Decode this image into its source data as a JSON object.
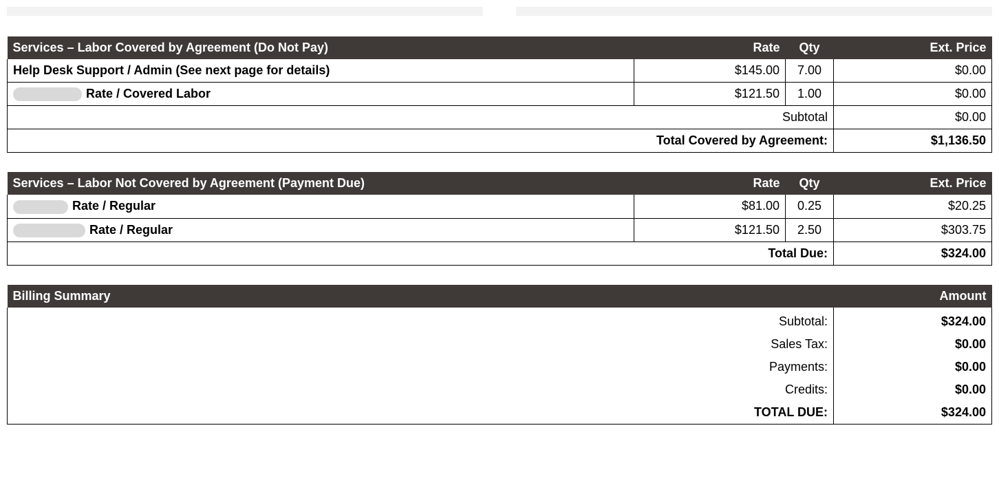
{
  "covered": {
    "title": "Services – Labor Covered by Agreement (Do Not Pay)",
    "cols": {
      "rate": "Rate",
      "qty": "Qty",
      "ext": "Ext. Price"
    },
    "rows": [
      {
        "desc": "Help Desk Support / Admin (See next page for details)",
        "rate": "$145.00",
        "qty": "7.00",
        "ext": "$0.00",
        "redact_w": 0
      },
      {
        "desc": "Rate / Covered Labor",
        "rate": "$121.50",
        "qty": "1.00",
        "ext": "$0.00",
        "redact_w": 100
      }
    ],
    "totals": [
      {
        "label": "Subtotal",
        "value": "$0.00",
        "bold": false
      },
      {
        "label": "Total Covered by Agreement:",
        "value": "$1,136.50",
        "bold": true
      }
    ]
  },
  "notcovered": {
    "title": "Services – Labor Not Covered by Agreement (Payment Due)",
    "cols": {
      "rate": "Rate",
      "qty": "Qty",
      "ext": "Ext. Price"
    },
    "rows": [
      {
        "desc": "Rate / Regular",
        "rate": "$81.00",
        "qty": "0.25",
        "ext": "$20.25",
        "redact_w": 80
      },
      {
        "desc": "Rate / Regular",
        "rate": "$121.50",
        "qty": "2.50",
        "ext": "$303.75",
        "redact_w": 105
      }
    ],
    "totals": [
      {
        "label": "Total Due:",
        "value": "$324.00",
        "bold": true
      }
    ]
  },
  "billing": {
    "title": "Billing Summary",
    "cols": {
      "amount": "Amount"
    },
    "rows": [
      {
        "label": "Subtotal:",
        "value": "$324.00",
        "bold_val": true
      },
      {
        "label": "Sales Tax:",
        "value": "$0.00",
        "bold_val": true
      },
      {
        "label": "Payments:",
        "value": "$0.00",
        "bold_val": true
      },
      {
        "label": "Credits:",
        "value": "$0.00",
        "bold_val": true
      },
      {
        "label": "TOTAL DUE:",
        "value": "$324.00",
        "bold_val": true,
        "bold_lbl": true
      }
    ]
  }
}
